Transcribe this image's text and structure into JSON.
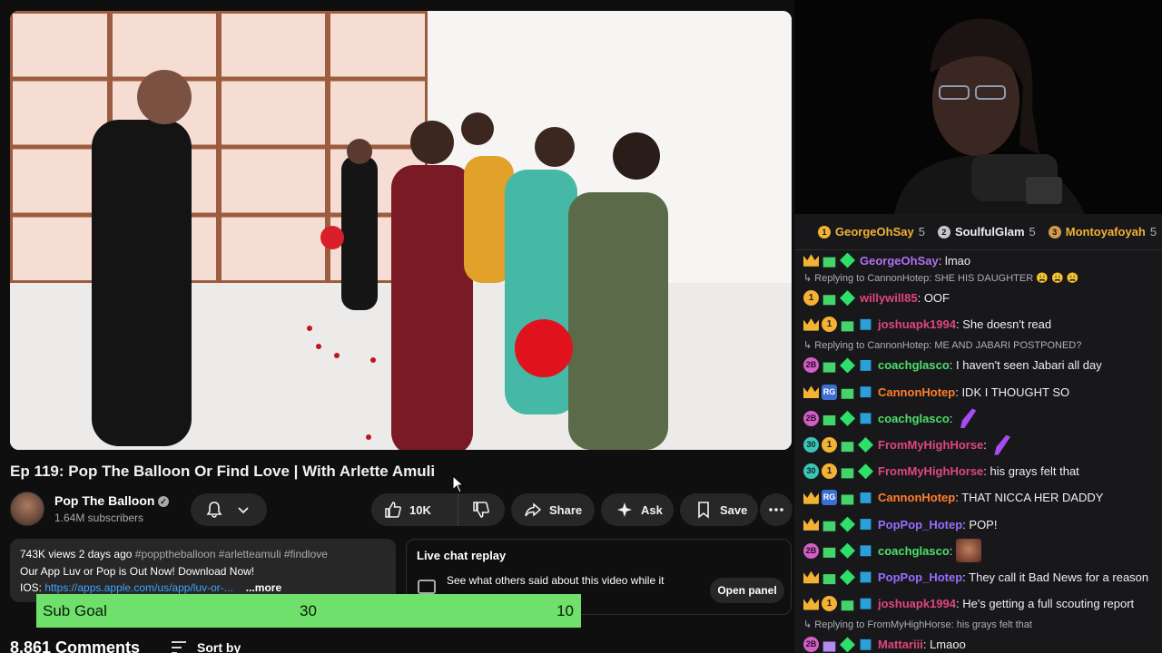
{
  "video": {
    "title": "Ep 119: Pop The Balloon Or Find Love | With Arlette Amuli"
  },
  "channel": {
    "name": "Pop The Balloon",
    "subscribers": "1.64M subscribers"
  },
  "actions": {
    "like_count": "10K",
    "share_label": "Share",
    "ask_label": "Ask",
    "save_label": "Save"
  },
  "description": {
    "stats": "743K views  2 days ago",
    "tags": "#popptheballoon #arletteamuli #findlove",
    "line1": "Our App Luv or Pop is Out Now! Download Now!",
    "line2_prefix": "IOS: ",
    "line2_link": "https://apps.apple.com/us/app/luv-or-...",
    "more_label": "...more"
  },
  "live_chat_replay": {
    "title": "Live chat replay",
    "text": "See what others said about this video while it",
    "button": "Open panel"
  },
  "sub_goal": {
    "label": "Sub Goal",
    "current": "30",
    "goal": "10",
    "bar_color": "#6fe06b"
  },
  "comments": {
    "count_label": "8,861 Comments",
    "sort_label": "Sort by"
  },
  "top_chatters": [
    {
      "rank": "1",
      "name": "GeorgeOhSay",
      "count": "5",
      "name_color": "#f3b233",
      "rank_color": "#f3b233"
    },
    {
      "rank": "2",
      "name": "SoulfulGlam",
      "count": "5",
      "name_color": "#efeff1",
      "rank_color": "#c7c7cc"
    },
    {
      "rank": "3",
      "name": "Montoyafoyah",
      "count": "5",
      "name_color": "#f3b233",
      "rank_color": "#d39a4b"
    }
  ],
  "chat": {
    "messages": [
      {
        "user": "GeorgeOhSay",
        "color": "#b16ff3",
        "text": ": lmao",
        "badges": [
          "crown",
          "gift",
          "gem"
        ]
      },
      {
        "reply": "Replying to CannonHotep: SHE HIS DAUGHTER 😩 😩 😩"
      },
      {
        "user": "willywill85",
        "color": "#e0467c",
        "text": ": OOF",
        "badges": [
          "coin",
          "gift",
          "gem"
        ]
      },
      {
        "user": "joshuapk1994",
        "color": "#e0467c",
        "text": ": She doesn't read",
        "badges": [
          "crown",
          "coin",
          "gift",
          "prime"
        ]
      },
      {
        "reply": "Replying to CannonHotep: ME AND JABARI POSTPONED?"
      },
      {
        "user": "coachglasco",
        "color": "#4de06a",
        "text": ": I haven't seen Jabari all day",
        "badges": [
          "pink",
          "gift",
          "gem",
          "prime"
        ]
      },
      {
        "user": "CannonHotep",
        "color": "#ff7f2a",
        "text": ": IDK I THOUGHT SO",
        "badges": [
          "crown",
          "rg",
          "gift",
          "prime"
        ]
      },
      {
        "user": "coachglasco",
        "color": "#4de06a",
        "text": ":",
        "emote": "feather",
        "badges": [
          "pink",
          "gift",
          "gem",
          "prime"
        ]
      },
      {
        "user": "FromMyHighHorse",
        "color": "#e0467c",
        "text": ":",
        "emote": "feather",
        "badges": [
          "teal",
          "coin",
          "gift",
          "gem"
        ]
      },
      {
        "user": "FromMyHighHorse",
        "color": "#e0467c",
        "text": ": his grays felt that",
        "badges": [
          "teal",
          "coin",
          "gift",
          "gem"
        ]
      },
      {
        "user": "CannonHotep",
        "color": "#ff7f2a",
        "text": ": THAT NICCA HER DADDY",
        "badges": [
          "crown",
          "rg",
          "gift",
          "prime"
        ]
      },
      {
        "user": "PopPop_Hotep",
        "color": "#9b6bff",
        "text": ": POP!",
        "badges": [
          "crown",
          "gift",
          "gem",
          "prime"
        ]
      },
      {
        "user": "coachglasco",
        "color": "#4de06a",
        "text": ":",
        "emote": "face",
        "badges": [
          "pink",
          "gift",
          "gem",
          "prime"
        ]
      },
      {
        "user": "PopPop_Hotep",
        "color": "#9b6bff",
        "text": ": They call it Bad News for a reason",
        "badges": [
          "crown",
          "gift",
          "gem",
          "prime"
        ]
      },
      {
        "user": "joshuapk1994",
        "color": "#e0467c",
        "text": ": He's getting a full scouting report",
        "badges": [
          "crown",
          "coin",
          "gift",
          "prime"
        ]
      },
      {
        "reply": "Replying to FromMyHighHorse: his grays felt that"
      },
      {
        "user": "Mattariii",
        "color": "#e0467c",
        "text": ": Lmaoo",
        "badges": [
          "pink",
          "purplegift",
          "gem",
          "prime"
        ]
      }
    ]
  },
  "badge_labels": {
    "coin": "1",
    "teal": "30",
    "pink": "2B",
    "rg": "RG"
  }
}
